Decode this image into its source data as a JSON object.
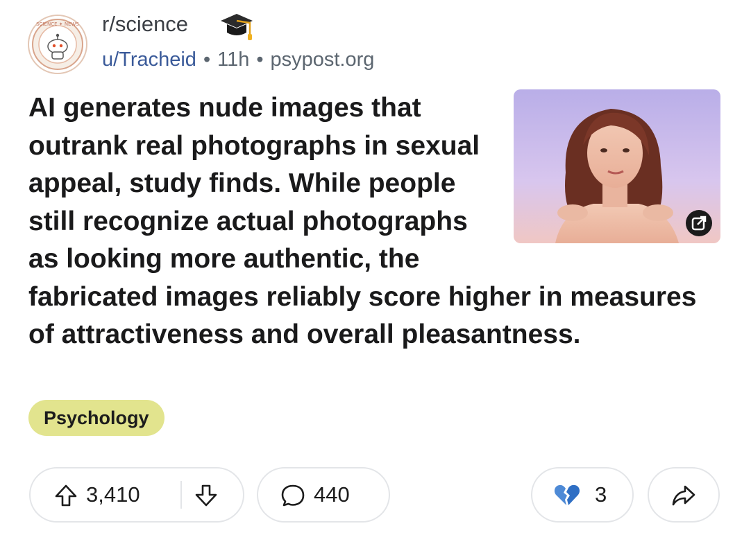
{
  "header": {
    "subreddit": "r/science",
    "subreddit_icon": "science-community-avatar",
    "badge_icon": "mortarboard-icon",
    "author": "u/Tracheid",
    "separator": "•",
    "age": "11h",
    "domain": "psypost.org"
  },
  "post": {
    "title": "AI generates nude images that outrank real photographs in sexual appeal, study finds. While people still recognize actual photographs as looking more authentic, the fabricated images reliably score higher in measures of attractiveness and overall pleasantness.",
    "thumbnail_icon": "article-thumbnail",
    "external_link_icon": "external-link-icon",
    "flair": "Psychology",
    "flair_color": "#e2e48e"
  },
  "actions": {
    "upvote_icon": "upvote-arrow-icon",
    "score": "3,410",
    "downvote_icon": "downvote-arrow-icon",
    "comment_icon": "comment-bubble-icon",
    "comments": "440",
    "award_icon": "broken-heart-icon",
    "awards": "3",
    "share_icon": "share-arrow-icon"
  },
  "colors": {
    "accent_link": "#3a5a99",
    "meta_text": "#5c6670",
    "pill_border": "#e3e5e8"
  }
}
